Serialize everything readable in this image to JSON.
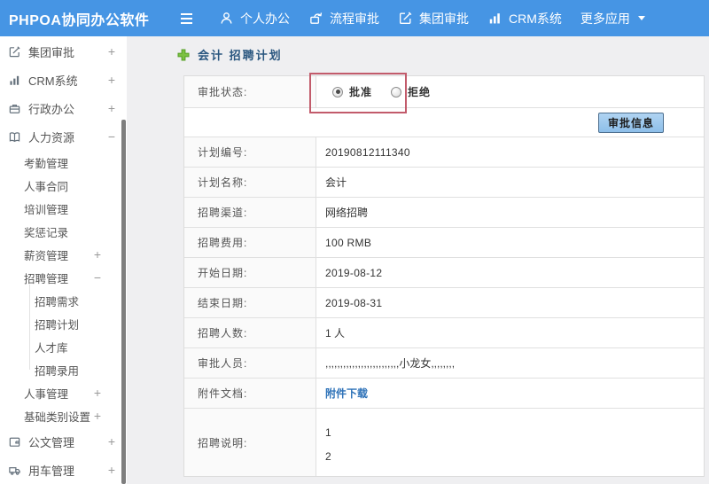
{
  "topbar": {
    "brand": "PHPOA协同办公软件",
    "nav": [
      {
        "label": "个人办公",
        "icon": "user-icon"
      },
      {
        "label": "流程审批",
        "icon": "flow-icon"
      },
      {
        "label": "集团审批",
        "icon": "edit-square-icon"
      },
      {
        "label": "CRM系统",
        "icon": "bar-chart-icon"
      },
      {
        "label": "更多应用",
        "icon": "caret-down-icon"
      }
    ]
  },
  "sidebar": {
    "items": [
      {
        "label": "集团审批",
        "expand": "+",
        "icon": "edit-square-icon"
      },
      {
        "label": "CRM系统",
        "expand": "+",
        "icon": "bar-chart-icon"
      },
      {
        "label": "行政办公",
        "expand": "+",
        "icon": "briefcase-icon"
      },
      {
        "label": "人力资源",
        "expand": "−",
        "icon": "book-icon"
      },
      {
        "label": "考勤管理"
      },
      {
        "label": "人事合同"
      },
      {
        "label": "培训管理"
      },
      {
        "label": "奖惩记录"
      },
      {
        "label": "薪资管理",
        "expand": "+"
      },
      {
        "label": "招聘管理",
        "expand": "−"
      },
      {
        "label": "招聘需求"
      },
      {
        "label": "招聘计划"
      },
      {
        "label": "人才库"
      },
      {
        "label": "招聘录用"
      },
      {
        "label": "人事管理",
        "expand": "+"
      },
      {
        "label": "基础类别设置",
        "expand": "+"
      },
      {
        "label": "公文管理",
        "expand": "+",
        "icon": "document-icon"
      },
      {
        "label": "用车管理",
        "expand": "+",
        "icon": "truck-icon"
      }
    ]
  },
  "main": {
    "title": "会计 招聘计划",
    "approve_button": "审批信息",
    "status": {
      "label": "审批状态:",
      "options": [
        {
          "label": "批准",
          "selected": true
        },
        {
          "label": "拒绝",
          "selected": false
        }
      ]
    },
    "rows": [
      {
        "label": "计划编号:",
        "value": "20190812111340"
      },
      {
        "label": "计划名称:",
        "value": "会计"
      },
      {
        "label": "招聘渠道:",
        "value": "网络招聘"
      },
      {
        "label": "招聘费用:",
        "value": "100 RMB"
      },
      {
        "label": "开始日期:",
        "value": "2019-08-12"
      },
      {
        "label": "结束日期:",
        "value": "2019-08-31"
      },
      {
        "label": "招聘人数:",
        "value": "1 人"
      },
      {
        "label": "审批人员:",
        "value": ",,,,,,,,,,,,,,,,,,,,,,,,,小龙女,,,,,,,,"
      },
      {
        "label": "附件文档:",
        "value": "附件下载"
      }
    ],
    "description": {
      "label": "招聘说明:",
      "lines": [
        "1",
        "2"
      ]
    }
  },
  "colors": {
    "topbar_blue": "#4695e4",
    "title_blue": "#29567f",
    "link_blue": "#2e72b8",
    "annotation_red": "#c25b6b",
    "button_blue": "#9cc8ee"
  }
}
